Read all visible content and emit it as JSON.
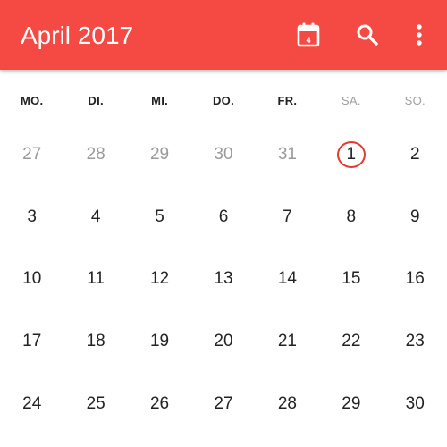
{
  "app_bar": {
    "title": "April 2017",
    "today_icon": "calendar-today-icon",
    "today_number": "4",
    "search_icon": "search-icon",
    "more_icon": "more-vert-icon",
    "accent_color": "#f44a43"
  },
  "weekdays": [
    {
      "label": "MO.",
      "weekend": false
    },
    {
      "label": "DI.",
      "weekend": false
    },
    {
      "label": "MI.",
      "weekend": false
    },
    {
      "label": "DO.",
      "weekend": false
    },
    {
      "label": "FR.",
      "weekend": false
    },
    {
      "label": "SA.",
      "weekend": true
    },
    {
      "label": "SO.",
      "weekend": true
    }
  ],
  "weeks": [
    [
      {
        "day": "27",
        "in_month": false
      },
      {
        "day": "28",
        "in_month": false
      },
      {
        "day": "29",
        "in_month": false
      },
      {
        "day": "30",
        "in_month": false
      },
      {
        "day": "31",
        "in_month": false
      },
      {
        "day": "1",
        "in_month": true,
        "selected": true
      },
      {
        "day": "2",
        "in_month": true
      }
    ],
    [
      {
        "day": "3",
        "in_month": true
      },
      {
        "day": "4",
        "in_month": true
      },
      {
        "day": "5",
        "in_month": true
      },
      {
        "day": "6",
        "in_month": true
      },
      {
        "day": "7",
        "in_month": true
      },
      {
        "day": "8",
        "in_month": true
      },
      {
        "day": "9",
        "in_month": true
      }
    ],
    [
      {
        "day": "10",
        "in_month": true
      },
      {
        "day": "11",
        "in_month": true
      },
      {
        "day": "12",
        "in_month": true
      },
      {
        "day": "13",
        "in_month": true
      },
      {
        "day": "14",
        "in_month": true
      },
      {
        "day": "15",
        "in_month": true
      },
      {
        "day": "16",
        "in_month": true
      }
    ],
    [
      {
        "day": "17",
        "in_month": true
      },
      {
        "day": "18",
        "in_month": true
      },
      {
        "day": "19",
        "in_month": true
      },
      {
        "day": "20",
        "in_month": true
      },
      {
        "day": "21",
        "in_month": true
      },
      {
        "day": "22",
        "in_month": true
      },
      {
        "day": "23",
        "in_month": true
      }
    ],
    [
      {
        "day": "24",
        "in_month": true
      },
      {
        "day": "25",
        "in_month": true
      },
      {
        "day": "26",
        "in_month": true
      },
      {
        "day": "27",
        "in_month": true
      },
      {
        "day": "28",
        "in_month": true
      },
      {
        "day": "29",
        "in_month": true
      },
      {
        "day": "30",
        "in_month": true
      }
    ]
  ]
}
